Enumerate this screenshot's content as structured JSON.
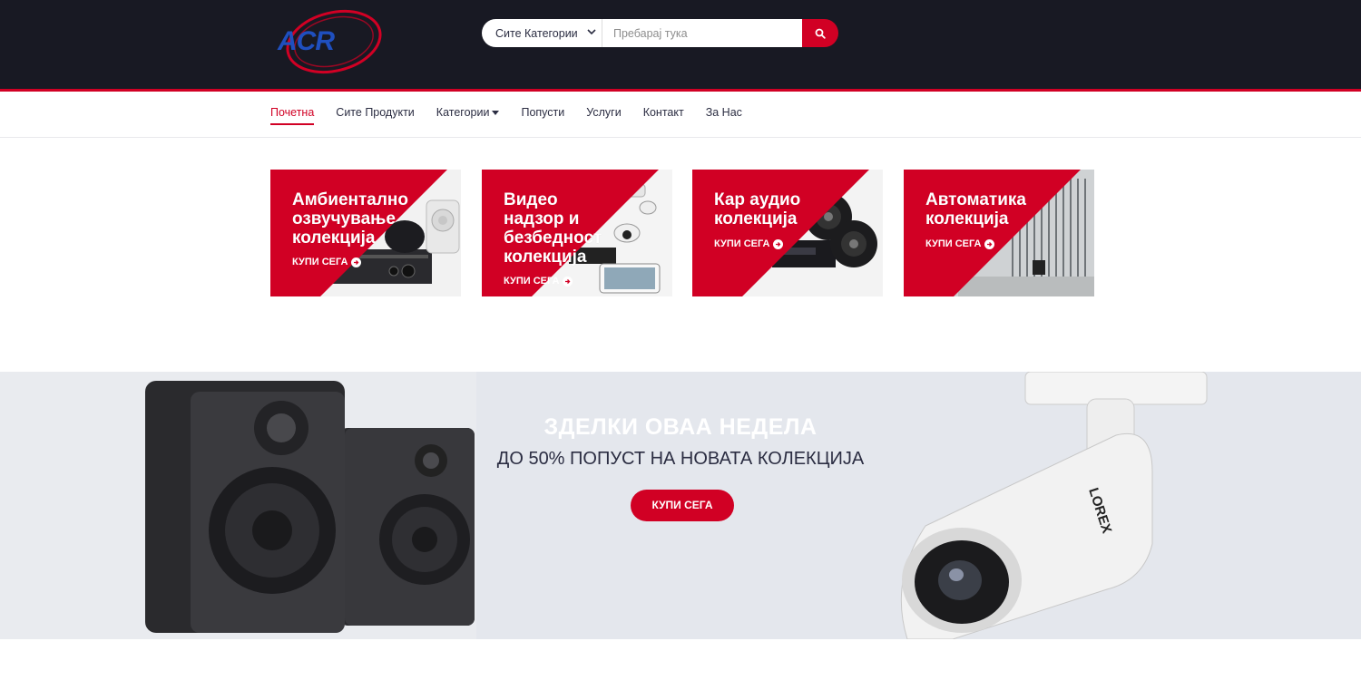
{
  "header": {
    "logo_text": "ACR",
    "search": {
      "category_selected": "Сите Категории",
      "placeholder": "Пребарај тука"
    }
  },
  "nav": {
    "items": [
      {
        "label": "Почетна"
      },
      {
        "label": "Сите Продукти"
      },
      {
        "label": "Категории"
      },
      {
        "label": "Попусти"
      },
      {
        "label": "Услуги"
      },
      {
        "label": "Контакт"
      },
      {
        "label": "За Нас"
      }
    ]
  },
  "collections": [
    {
      "title_lines": [
        "Амбиентално",
        "озвучување",
        "колекција"
      ],
      "cta": "КУПИ СЕГА"
    },
    {
      "title_lines": [
        "Видео",
        "надзор и",
        "безбедност",
        "колекција"
      ],
      "cta": "КУПИ СЕГА"
    },
    {
      "title_lines": [
        "Кар аудио",
        "колекција"
      ],
      "cta": "КУПИ СЕГА"
    },
    {
      "title_lines": [
        "Автоматика",
        "колекција"
      ],
      "cta": "КУПИ СЕГА"
    }
  ],
  "deal": {
    "title": "ЗДЕЛКИ ОВАА НЕДЕЛА",
    "subtitle": "ДО 50% ПОПУСТ НА НОВАТА КОЛЕКЦИЈА",
    "button": "КУПИ СЕГА",
    "camera_brand": "LOREX"
  },
  "colors": {
    "accent": "#d10024",
    "header_bg": "#181923",
    "text_dark": "#2b2d42",
    "deal_bg": "#e4e7ed"
  }
}
